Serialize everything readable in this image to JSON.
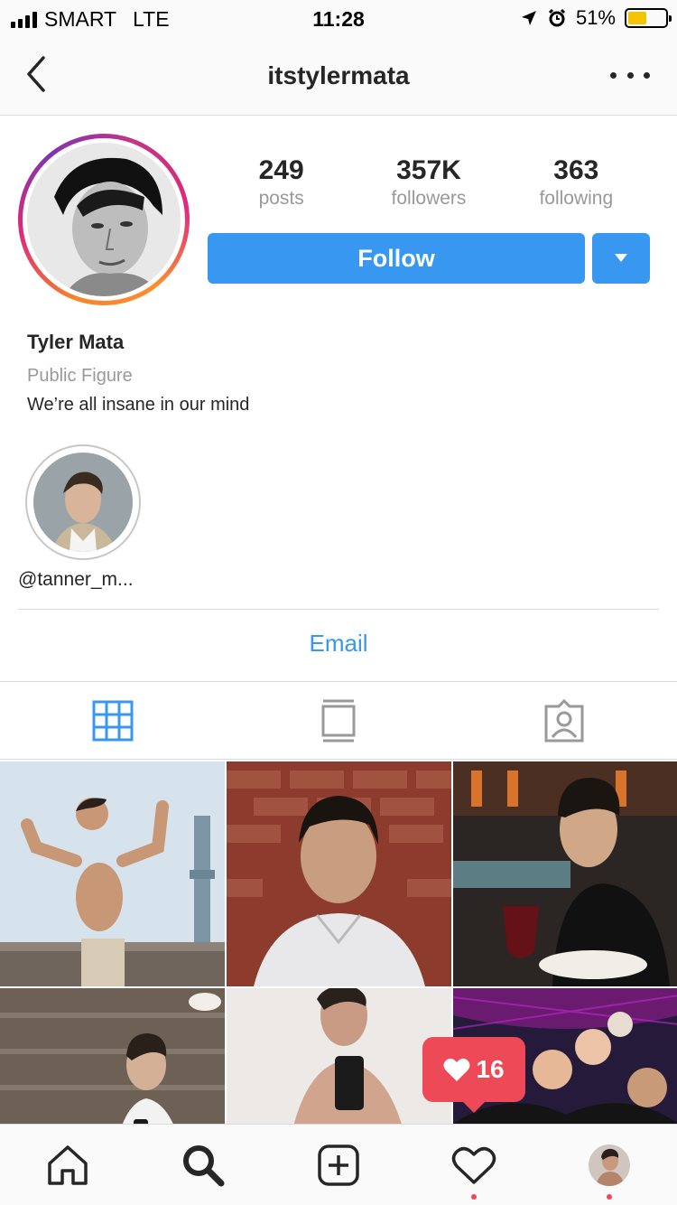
{
  "status_bar": {
    "carrier": "SMART",
    "network": "LTE",
    "time": "11:28",
    "battery": "51%",
    "battery_level": 0.51,
    "icons": [
      "signal-icon",
      "location-arrow-icon",
      "alarm-icon",
      "battery-icon"
    ]
  },
  "nav": {
    "title": "itstylermata",
    "back_icon": "chevron-left-icon",
    "more_icon": "more-dots-icon"
  },
  "profile": {
    "stats": [
      {
        "value": "249",
        "label": "posts"
      },
      {
        "value": "357K",
        "label": "followers"
      },
      {
        "value": "363",
        "label": "following"
      }
    ],
    "follow_label": "Follow",
    "dropdown_icon": "caret-down-icon",
    "name": "Tyler Mata",
    "category": "Public Figure",
    "bio": "We’re all insane in our mind"
  },
  "highlights": [
    {
      "label": "@tanner_m..."
    }
  ],
  "contact": {
    "email_label": "Email"
  },
  "tabs": [
    {
      "icon": "grid-icon",
      "active": true
    },
    {
      "icon": "feed-icon",
      "active": false
    },
    {
      "icon": "tagged-icon",
      "active": false
    }
  ],
  "grid_posts_count": 6,
  "activity": {
    "likes": "16",
    "icon": "heart-icon"
  },
  "bottom_nav": {
    "items": [
      "home-icon",
      "search-icon",
      "add-post-icon",
      "activity-heart-icon",
      "profile-avatar"
    ]
  },
  "colors": {
    "accent": "#3897f0",
    "notification": "#ed4956",
    "text": "#262626",
    "muted": "#999999"
  }
}
